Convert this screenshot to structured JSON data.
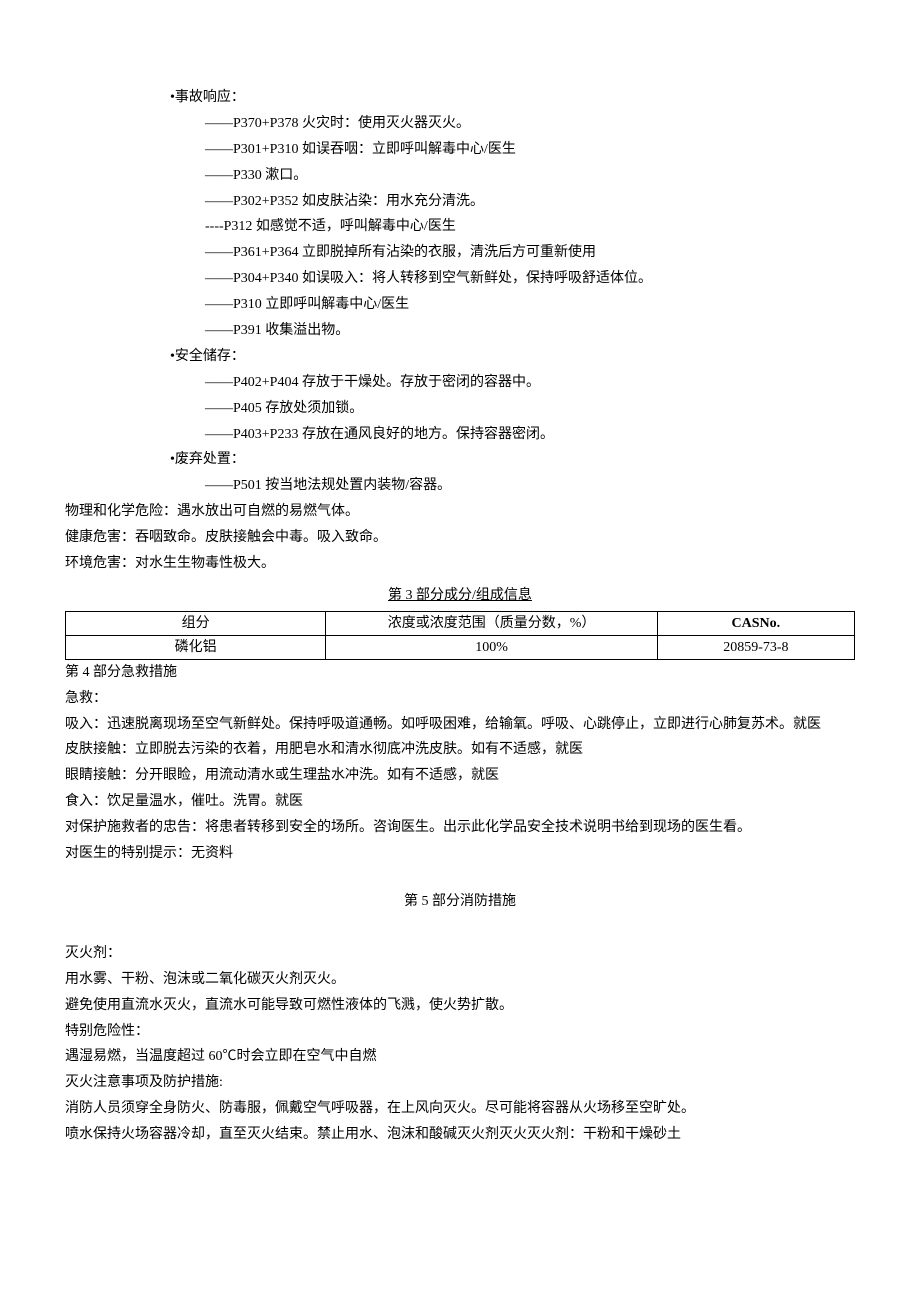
{
  "response": {
    "title": "•事故响应：",
    "items": [
      "——P370+P378 火灾时：使用灭火器灭火。",
      "——P301+P310 如误吞咽：立即呼叫解毒中心/医生",
      "——P330 漱口。",
      "——P302+P352 如皮肤沾染：用水充分清洗。",
      "----P312 如感觉不适，呼叫解毒中心/医生",
      "——P361+P364 立即脱掉所有沾染的衣服，清洗后方可重新使用",
      "——P304+P340 如误吸入：将人转移到空气新鲜处，保持呼吸舒适体位。",
      "——P310 立即呼叫解毒中心/医生",
      "——P391 收集溢出物。"
    ]
  },
  "storage": {
    "title": "•安全储存：",
    "items": [
      "——P402+P404 存放于干燥处。存放于密闭的容器中。",
      "——P405 存放处须加锁。",
      "——P403+P233 存放在通风良好的地方。保持容器密闭。"
    ]
  },
  "disposal": {
    "title": "•废弃处置：",
    "items": [
      "——P501 按当地法规处置内装物/容器。"
    ]
  },
  "hazards": [
    "物理和化学危险：遇水放出可自燃的易燃气体。",
    "健康危害：吞咽致命。皮肤接触会中毒。吸入致命。",
    "环境危害：对水生生物毒性极大。"
  ],
  "section3": {
    "title": "第 3 部分成分/组成信息",
    "headers": [
      "组分",
      "浓度或浓度范围（质量分数，%）",
      "CASNo."
    ],
    "row": [
      "磷化铝",
      "100%",
      "20859-73-8"
    ]
  },
  "section4": {
    "title": "第 4 部分急救措施",
    "lines": [
      "急救：",
      "吸入：迅速脱离现场至空气新鲜处。保持呼吸道通畅。如呼吸困难，给输氧。呼吸、心跳停止，立即进行心肺复苏术。就医",
      "皮肤接触：立即脱去污染的衣着，用肥皂水和清水彻底冲洗皮肤。如有不适感，就医",
      "眼睛接触：分开眼睑，用流动清水或生理盐水冲洗。如有不适感，就医",
      "食入：饮足量温水，催吐。洗胃。就医",
      "对保护施救者的忠告：将患者转移到安全的场所。咨询医生。出示此化学品安全技术说明书给到现场的医生看。",
      "对医生的特别提示：无资料"
    ]
  },
  "section5": {
    "title": "第 5 部分消防措施",
    "lines": [
      "灭火剂：",
      "用水雾、干粉、泡沫或二氧化碳灭火剂灭火。",
      "避免使用直流水灭火，直流水可能导致可燃性液体的飞溅，使火势扩散。",
      "特别危险性：",
      "遇湿易燃，当温度超过 60℃时会立即在空气中自燃",
      "灭火注意事项及防护措施:",
      "消防人员须穿全身防火、防毒服，佩戴空气呼吸器，在上风向灭火。尽可能将容器从火场移至空旷处。",
      "喷水保持火场容器冷却，直至灭火结束。禁止用水、泡沫和酸碱灭火剂灭火灭火剂：干粉和干燥砂土"
    ]
  }
}
